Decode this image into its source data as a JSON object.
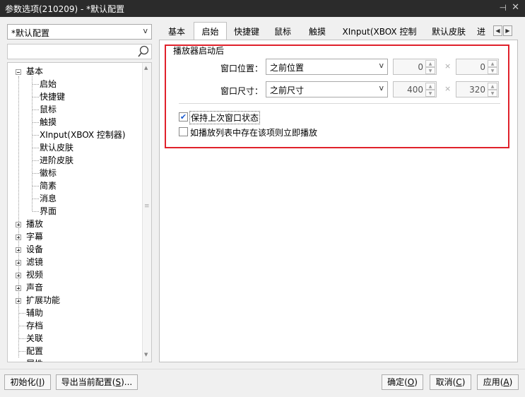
{
  "window": {
    "title": "参数选项(210209) - *默认配置",
    "pin_glyph": "⊣",
    "close_glyph": "✕"
  },
  "profile": {
    "selected": "*默认配置"
  },
  "tree": {
    "items": [
      {
        "label": "基本",
        "expanded": true
      },
      {
        "label": "启始",
        "selected": true
      },
      {
        "label": "快捷键"
      },
      {
        "label": "鼠标"
      },
      {
        "label": "触摸"
      },
      {
        "label": "XInput(XBOX 控制器)"
      },
      {
        "label": "默认皮肤"
      },
      {
        "label": "进阶皮肤"
      },
      {
        "label": "徽标"
      },
      {
        "label": "简素"
      },
      {
        "label": "消息"
      },
      {
        "label": "界面"
      },
      {
        "label": "播放",
        "expandable": true
      },
      {
        "label": "字幕",
        "expandable": true
      },
      {
        "label": "设备",
        "expandable": true
      },
      {
        "label": "滤镜",
        "expandable": true
      },
      {
        "label": "视频",
        "expandable": true
      },
      {
        "label": "声音",
        "expandable": true
      },
      {
        "label": "扩展功能",
        "expandable": true
      },
      {
        "label": "辅助"
      },
      {
        "label": "存档"
      },
      {
        "label": "关联"
      },
      {
        "label": "配置"
      },
      {
        "label": "属性"
      }
    ]
  },
  "tabs": [
    {
      "label": "基本"
    },
    {
      "label": "启始",
      "active": true
    },
    {
      "label": "快捷键"
    },
    {
      "label": "鼠标"
    },
    {
      "label": "触摸"
    },
    {
      "label": "XInput(XBOX 控制器)"
    },
    {
      "label": "默认皮肤"
    },
    {
      "label": "进阶"
    }
  ],
  "group": {
    "title": "播放器启动后",
    "position": {
      "label": "窗口位置：",
      "value": "之前位置",
      "x": "0",
      "y": "0"
    },
    "size": {
      "label": "窗口尺寸：",
      "value": "之前尺寸",
      "w": "400",
      "h": "320"
    },
    "times_glyph": "×",
    "keep_state": {
      "label": "保持上次窗口状态",
      "checked": true
    },
    "play_immediately": {
      "label": "如播放列表中存在该项则立即播放",
      "checked": false
    }
  },
  "buttons": {
    "init": {
      "text": "初始化(",
      "key": "I",
      "tail": ")"
    },
    "export": {
      "text": "导出当前配置(",
      "key": "S",
      "tail": ")..."
    },
    "ok": {
      "text": "确定(",
      "key": "O",
      "tail": ")"
    },
    "cancel": {
      "text": "取消(",
      "key": "C",
      "tail": ")"
    },
    "apply": {
      "text": "应用(",
      "key": "A",
      "tail": ")"
    }
  },
  "colors": {
    "titlebar": "#2b2b2b",
    "highlight_border": "#e0212b",
    "check": "#1a5ad0"
  }
}
